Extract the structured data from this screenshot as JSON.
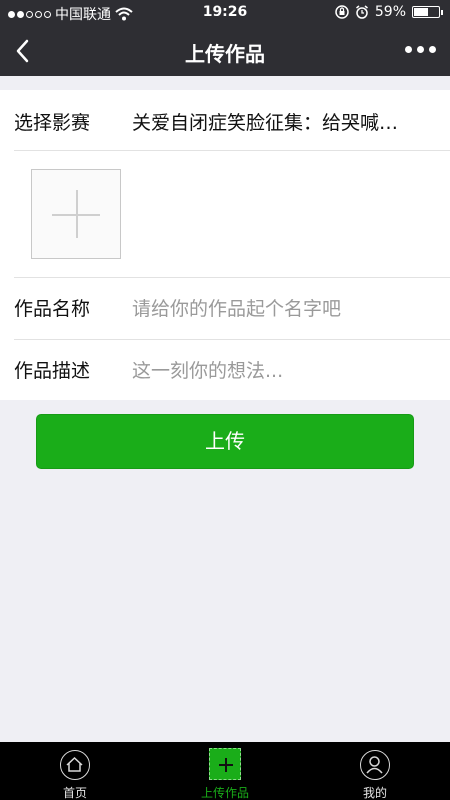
{
  "status_bar": {
    "carrier": "中国联通",
    "time": "19:26",
    "battery_percent": "59%",
    "battery_level": 0.59,
    "signal_bars_filled": 2,
    "signal_bars_total": 5
  },
  "nav": {
    "title": "上传作品"
  },
  "form": {
    "contest_label": "选择影赛",
    "contest_value": "关爱自闭症笑脸征集：给哭喊…",
    "name_label": "作品名称",
    "name_placeholder": "请给你的作品起个名字吧",
    "desc_label": "作品描述",
    "desc_placeholder": "这一刻你的想法..."
  },
  "submit": {
    "label": "上传"
  },
  "tab_bar": {
    "items": [
      {
        "label": "首页",
        "icon": "home-icon"
      },
      {
        "label": "上传作品",
        "icon": "add-icon"
      },
      {
        "label": "我的",
        "icon": "user-icon"
      }
    ],
    "active_index": 1
  },
  "colors": {
    "bar_bg": "#2e2e33",
    "accent": "#1aad19",
    "page_bg": "#efeff4"
  }
}
